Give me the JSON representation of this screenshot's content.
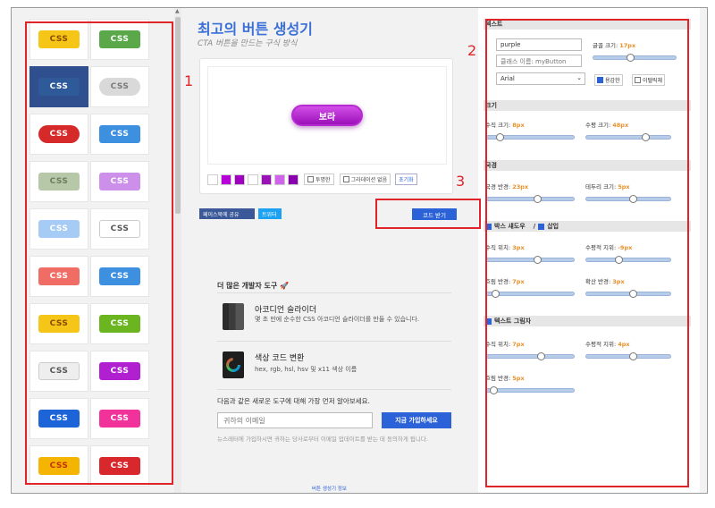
{
  "app": {
    "title": "최고의 버튼 생성기",
    "subtitle": "CTA 버튼을 만드는 구식 방식"
  },
  "gallery": {
    "label": "CSS",
    "buttons": [
      {
        "bg": "#f5c518",
        "fg": "#8a4a00"
      },
      {
        "bg": "#5aa84a",
        "fg": "#ffffff"
      },
      {
        "bg": "#2f5a9a",
        "fg": "#ffffff",
        "selected": true
      },
      {
        "bg": "#d9d9d9",
        "fg": "#7a7a7a",
        "pill": true
      },
      {
        "bg": "#d62a2a",
        "fg": "#ffffff",
        "pill": true
      },
      {
        "bg": "#3d8fe0",
        "fg": "#ffffff"
      },
      {
        "bg": "#b6c8a8",
        "fg": "#6d7d62"
      },
      {
        "bg": "#cc90ea",
        "fg": "#ffffff"
      },
      {
        "bg": "#a6ccf6",
        "fg": "#ffffff"
      },
      {
        "bg": "#ffffff",
        "fg": "#555555"
      },
      {
        "bg": "#f06d66",
        "fg": "#ffffff"
      },
      {
        "bg": "#3d8fe0",
        "fg": "#ffffff"
      },
      {
        "bg": "#f5c518",
        "fg": "#8a4a00"
      },
      {
        "bg": "#6bb520",
        "fg": "#ffffff"
      },
      {
        "bg": "#eeeeee",
        "fg": "#555555"
      },
      {
        "bg": "#b020d0",
        "fg": "#ffffff"
      },
      {
        "bg": "#1c64d8",
        "fg": "#ffffff"
      },
      {
        "bg": "#f0329a",
        "fg": "#ffffff"
      },
      {
        "bg": "#f5b400",
        "fg": "#c43010"
      },
      {
        "bg": "#d8282c",
        "fg": "#ffffff"
      }
    ]
  },
  "preview": {
    "button_text": "보라",
    "swatches": [
      "#ffffff",
      "#b700d8",
      "#a000c0",
      "#ffffff",
      "#9b10b8",
      "#cf64ea",
      "#8a00b0"
    ],
    "transparent_label": "투명한",
    "no_gradient_label": "그라데이션 없음",
    "reset_label": "초기화"
  },
  "share": {
    "facebook": "페이스북에 공유",
    "twitter": "트위터"
  },
  "get_code": "코드 받기",
  "tools": {
    "heading": "더 많은 개발자 도구 🚀",
    "items": [
      {
        "name": "아코디언 슬라이더",
        "desc": "몇 초 만에 순수한 CSS 아코디언 슬라이더를 만들 수 있습니다."
      },
      {
        "name": "색상 코드 변환",
        "desc": "hex, rgb, hsl, hsv 및 x11 색상 이름"
      }
    ]
  },
  "newsletter": {
    "text": "다음과 같은 새로운 도구에 대해 가장 먼저 알아보세요.",
    "placeholder": "귀하의 이메일",
    "button": "지금 가입하세요",
    "disclaimer": "뉴스레터에 가입하시면 귀하는 당사로부터 이메일 업데이트를 받는 데 동의하게 됩니다."
  },
  "footer": "버튼 생성기 정보",
  "settings": {
    "text_section": "텍스트",
    "text_value": "purple",
    "class_name": "클래스 이름: myButton",
    "font": "Arial",
    "font_size_label": "글꼴 크기:",
    "font_size": "17px",
    "font_size_level": 0.45,
    "bold_label": "용감한",
    "bold": true,
    "italic_label": "이탤릭체",
    "italic": false,
    "size_section": "크기",
    "vpad_label": "수직 크기:",
    "vpad": "8px",
    "vpad_level": 0.15,
    "hpad_label": "수평 크기:",
    "hpad": "48px",
    "hpad_level": 0.7,
    "border_section": "국경",
    "radius_label": "국경 반경:",
    "radius": "23px",
    "radius_level": 0.58,
    "bwidth_label": "테두리 크기:",
    "bwidth": "5px",
    "bwidth_level": 0.55,
    "boxshadow_section": "박스 섀도우",
    "inset_label": "삽입",
    "bs_v_label": "수직 위치:",
    "bs_v": "3px",
    "bs_v_level": 0.58,
    "bs_h_label": "수평적 지위:",
    "bs_h": "-9px",
    "bs_h_level": 0.38,
    "bs_blur_label": "흐림 반경:",
    "bs_blur": "7px",
    "bs_blur_level": 0.1,
    "bs_spread_label": "확산 반경:",
    "bs_spread": "3px",
    "bs_spread_level": 0.55,
    "textshadow_section": "텍스트 그림자",
    "ts_v_label": "수직 위치:",
    "ts_v": "7px",
    "ts_v_level": 0.62,
    "ts_h_label": "수평적 지위:",
    "ts_h": "4px",
    "ts_h_level": 0.55,
    "ts_blur_label": "흐림 반경:",
    "ts_blur": "5px",
    "ts_blur_level": 0.08
  },
  "annotations": [
    "1",
    "2",
    "3"
  ]
}
